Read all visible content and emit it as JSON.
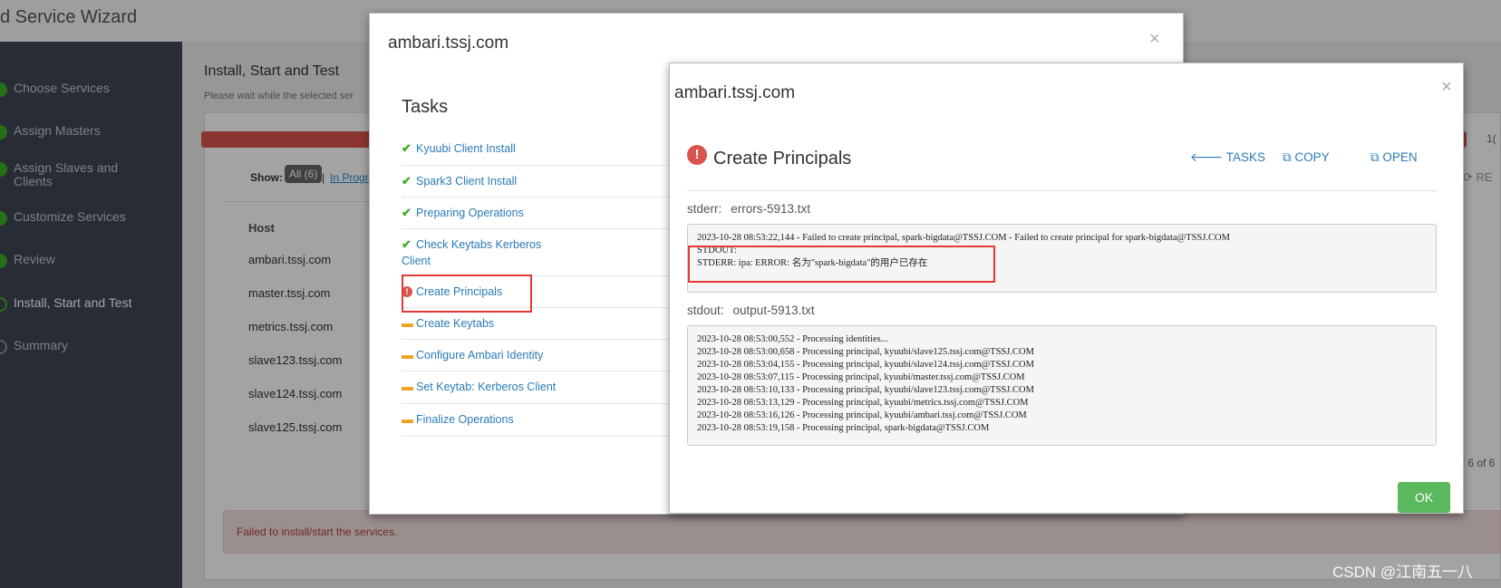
{
  "app": {
    "title": "d Service Wizard",
    "steps": [
      {
        "label": "Choose Services",
        "state": "done"
      },
      {
        "label": "Assign Masters",
        "state": "done"
      },
      {
        "label": "Assign Slaves and Clients",
        "state": "done"
      },
      {
        "label": "Customize Services",
        "state": "done"
      },
      {
        "label": "Review",
        "state": "done"
      },
      {
        "label": "Install, Start and Test",
        "state": "current"
      },
      {
        "label": "Summary",
        "state": "pending"
      }
    ],
    "content_title": "Install, Start and Test",
    "content_sub": "Please wait while the selected ser",
    "show_label": "Show:",
    "show_all": "All (6)",
    "show_sep": "|",
    "show_in_progress": "In Progr",
    "host_header": "Host",
    "hosts": [
      "ambari.tssj.com",
      "master.tssj.com",
      "metrics.tssj.com",
      "slave123.tssj.com",
      "slave124.tssj.com",
      "slave125.tssj.com"
    ],
    "progress_count": "1(",
    "refresh": "RE",
    "pagination": "- 6 of 6",
    "error_banner": "Failed to install/start the services."
  },
  "modal1": {
    "title": "ambari.tssj.com",
    "close": "×",
    "tasks_heading": "Tasks",
    "tasks": [
      {
        "label": "Kyuubi Client Install",
        "status": "ok"
      },
      {
        "label": "Spark3 Client Install",
        "status": "ok"
      },
      {
        "label": "Preparing Operations",
        "status": "ok"
      },
      {
        "label": "Check Keytabs Kerberos Client",
        "status": "ok"
      },
      {
        "label": "Create Principals",
        "status": "error"
      },
      {
        "label": "Create Keytabs",
        "status": "pending"
      },
      {
        "label": "Configure Ambari Identity",
        "status": "pending"
      },
      {
        "label": "Set Keytab: Kerberos Client",
        "status": "pending"
      },
      {
        "label": "Finalize Operations",
        "status": "pending"
      }
    ]
  },
  "modal2": {
    "title": "ambari.tssj.com",
    "close": "×",
    "task_title": "Create Principals",
    "tasks_link": "TASKS",
    "copy_link": "COPY",
    "open_link": "OPEN",
    "stderr_label": "stderr:",
    "stderr_file": "errors-5913.txt",
    "stderr_log": "2023-10-28 08:53:22,144 - Failed to create principal, spark-bigdata@TSSJ.COM - Failed to create principal for spark-bigdata@TSSJ.COM\nSTDOUT:\nSTDERR: ipa: ERROR: 名为\"spark-bigdata\"的用户已存在",
    "stdout_label": "stdout:",
    "stdout_file": "output-5913.txt",
    "stdout_log": "2023-10-28 08:53:00,552 - Processing identities...\n2023-10-28 08:53:00,658 - Processing principal, kyuubi/slave125.tssj.com@TSSJ.COM\n2023-10-28 08:53:04,155 - Processing principal, kyuubi/slave124.tssj.com@TSSJ.COM\n2023-10-28 08:53:07,115 - Processing principal, kyuubi/master.tssj.com@TSSJ.COM\n2023-10-28 08:53:10,133 - Processing principal, kyuubi/slave123.tssj.com@TSSJ.COM\n2023-10-28 08:53:13,129 - Processing principal, kyuubi/metrics.tssj.com@TSSJ.COM\n2023-10-28 08:53:16,126 - Processing principal, kyuubi/ambari.tssj.com@TSSJ.COM\n2023-10-28 08:53:19,158 - Processing principal, spark-bigdata@TSSJ.COM",
    "ok_label": "OK"
  },
  "watermark": "CSDN @江南五一八",
  "icons": {
    "ok": "check-icon",
    "pending": "dash-icon",
    "error": "exclamation-icon"
  },
  "colors": {
    "ok": "#3fae2a",
    "pending": "#f0a020",
    "error": "#d9534f",
    "link": "#2a7ab7",
    "ok_button": "#5cb85c"
  }
}
